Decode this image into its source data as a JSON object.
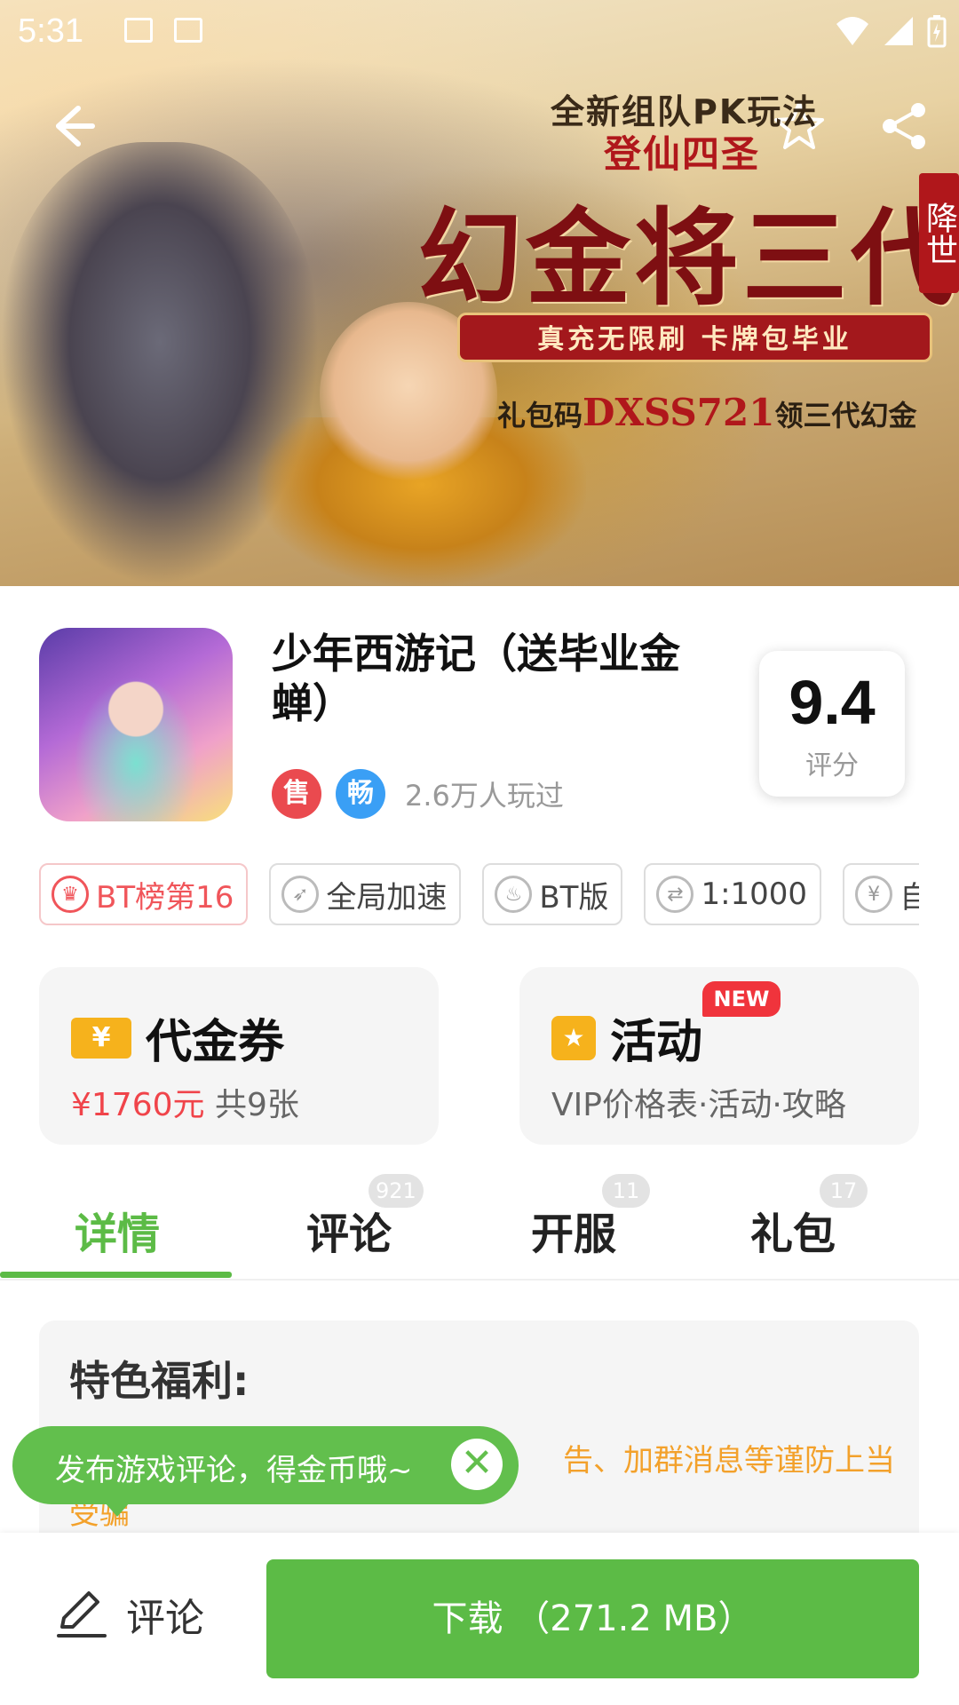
{
  "status_bar": {
    "time": "5:31"
  },
  "banner": {
    "line1": "全新组队PK玩法",
    "line2": "登仙四圣",
    "title": "幻金将三代",
    "badge": "降世",
    "ribbon": "真充无限刷 卡牌包毕业",
    "code_prefix": "礼包码",
    "code": "DXSS721",
    "code_suffix": "领三代幻金"
  },
  "app": {
    "name": "少年西游记（送毕业金蝉）",
    "badge_sale": "售",
    "badge_smooth": "畅",
    "played": "2.6万人玩过",
    "score": "9.4",
    "score_label": "评分"
  },
  "chips": [
    {
      "label": "BT榜第16",
      "icon": "trophy-icon",
      "highlight": true
    },
    {
      "label": "全局加速",
      "icon": "rocket-icon",
      "highlight": false
    },
    {
      "label": "BT版",
      "icon": "flame-icon",
      "highlight": false
    },
    {
      "label": "1:1000",
      "icon": "exchange-icon",
      "highlight": false
    },
    {
      "label": "自",
      "icon": "yen-icon",
      "highlight": false
    }
  ],
  "cards": {
    "coupon": {
      "title": "代金券",
      "icon_glyph": "¥",
      "amount": "¥1760元",
      "count": "共9张"
    },
    "activity": {
      "title": "活动",
      "badge": "NEW",
      "subtitle": "VIP价格表·活动·攻略"
    }
  },
  "tabs": [
    {
      "label": "详情",
      "count": null,
      "active": true
    },
    {
      "label": "评论",
      "count": "921",
      "active": false
    },
    {
      "label": "开服",
      "count": "11",
      "active": false
    },
    {
      "label": "礼包",
      "count": "17",
      "active": false
    }
  ],
  "detail": {
    "heading": "特色福利:",
    "warning": "告、加群消息等谨防上当受骗"
  },
  "toast": {
    "text": "发布游戏评论，得金币哦~",
    "close": "✕"
  },
  "bottom": {
    "comment_label": "评论",
    "download_label": "下载 （271.2 MB）"
  },
  "colors": {
    "accent": "#5cbb46",
    "red": "#f0444a",
    "warning": "#f3a12b"
  }
}
